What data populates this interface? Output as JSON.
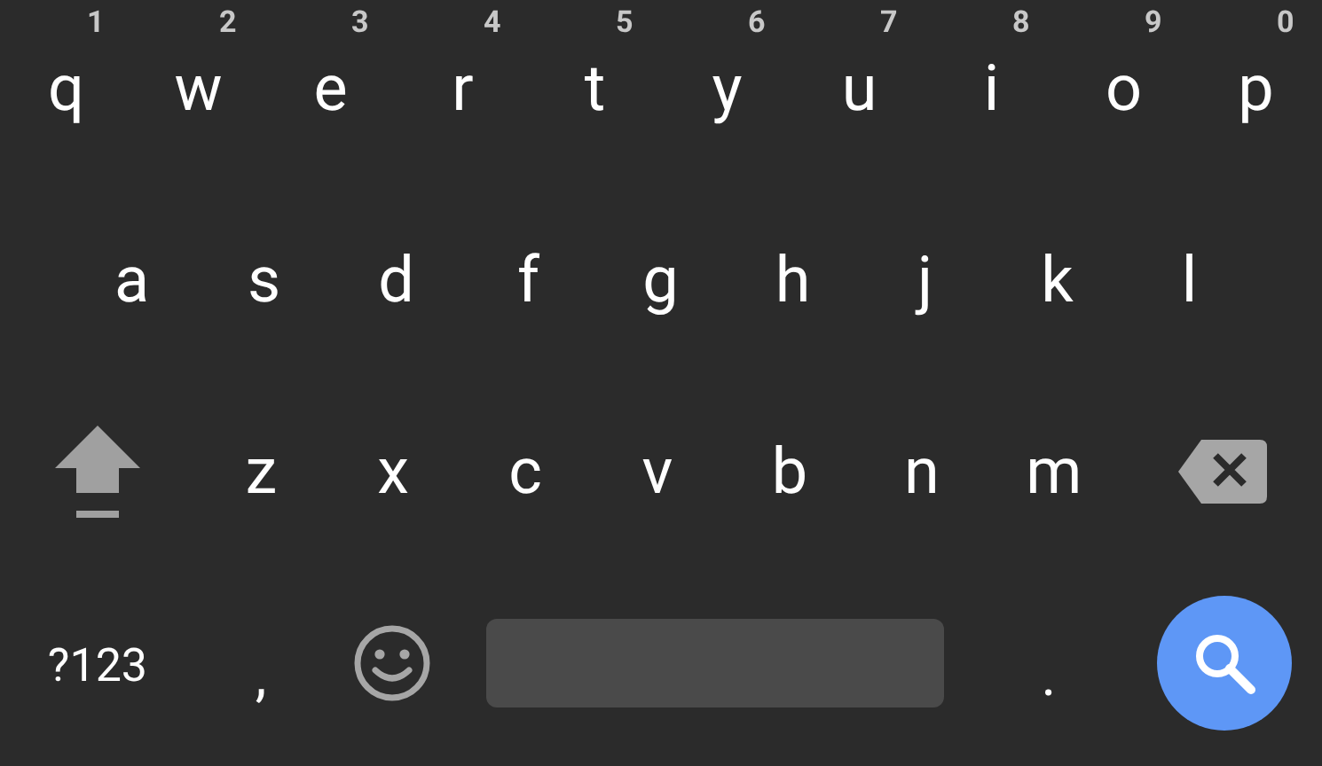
{
  "rows": [
    {
      "keys": [
        {
          "label": "q",
          "hint": "1"
        },
        {
          "label": "w",
          "hint": "2"
        },
        {
          "label": "e",
          "hint": "3"
        },
        {
          "label": "r",
          "hint": "4"
        },
        {
          "label": "t",
          "hint": "5"
        },
        {
          "label": "y",
          "hint": "6"
        },
        {
          "label": "u",
          "hint": "7"
        },
        {
          "label": "i",
          "hint": "8"
        },
        {
          "label": "o",
          "hint": "9"
        },
        {
          "label": "p",
          "hint": "0"
        }
      ]
    },
    {
      "keys": [
        {
          "label": "a"
        },
        {
          "label": "s"
        },
        {
          "label": "d"
        },
        {
          "label": "f"
        },
        {
          "label": "g"
        },
        {
          "label": "h"
        },
        {
          "label": "j"
        },
        {
          "label": "k"
        },
        {
          "label": "l"
        }
      ]
    },
    {
      "keys": [
        {
          "label": "z"
        },
        {
          "label": "x"
        },
        {
          "label": "c"
        },
        {
          "label": "v"
        },
        {
          "label": "b"
        },
        {
          "label": "n"
        },
        {
          "label": "m"
        }
      ]
    }
  ],
  "shift": {
    "on": false
  },
  "bottom_row": [
    {
      "kind": "text",
      "label": "?123"
    },
    {
      "kind": "text",
      "label": ","
    },
    {
      "kind": "emoji"
    },
    {
      "kind": "space"
    },
    {
      "kind": "text",
      "label": "."
    },
    {
      "kind": "search"
    }
  ]
}
